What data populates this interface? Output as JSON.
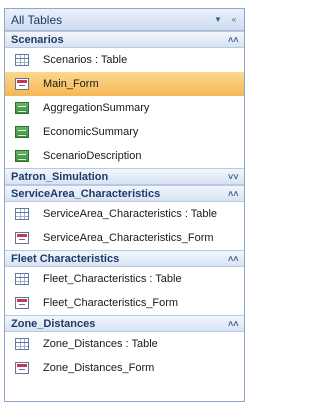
{
  "pane": {
    "title": "All Tables"
  },
  "groups": [
    {
      "name": "Scenarios",
      "items": [
        {
          "label": "Scenarios : Table"
        },
        {
          "label": "Main_Form"
        },
        {
          "label": "AggregationSummary"
        },
        {
          "label": "EconomicSummary"
        },
        {
          "label": "ScenarioDescription"
        }
      ]
    },
    {
      "name": "Patron_Simulation",
      "items": []
    },
    {
      "name": "ServiceArea_Characteristics",
      "items": [
        {
          "label": "ServiceArea_Characteristics : Table"
        },
        {
          "label": "ServiceArea_Characteristics_Form"
        }
      ]
    },
    {
      "name": "Fleet Characteristics",
      "items": [
        {
          "label": "Fleet_Characteristics : Table"
        },
        {
          "label": "Fleet_Characteristics_Form"
        }
      ]
    },
    {
      "name": "Zone_Distances",
      "items": [
        {
          "label": "Zone_Distances : Table"
        },
        {
          "label": "Zone_Distances_Form"
        }
      ]
    }
  ],
  "icons": {
    "dropdown": "chevron-down-icon",
    "close": "collapse-pane-icon",
    "expand": "double-chevron-down-icon",
    "collapse": "double-chevron-up-icon"
  },
  "colors": {
    "selected": "#f6b756",
    "header": "#d7e3f3",
    "border": "#8fa7c8"
  }
}
